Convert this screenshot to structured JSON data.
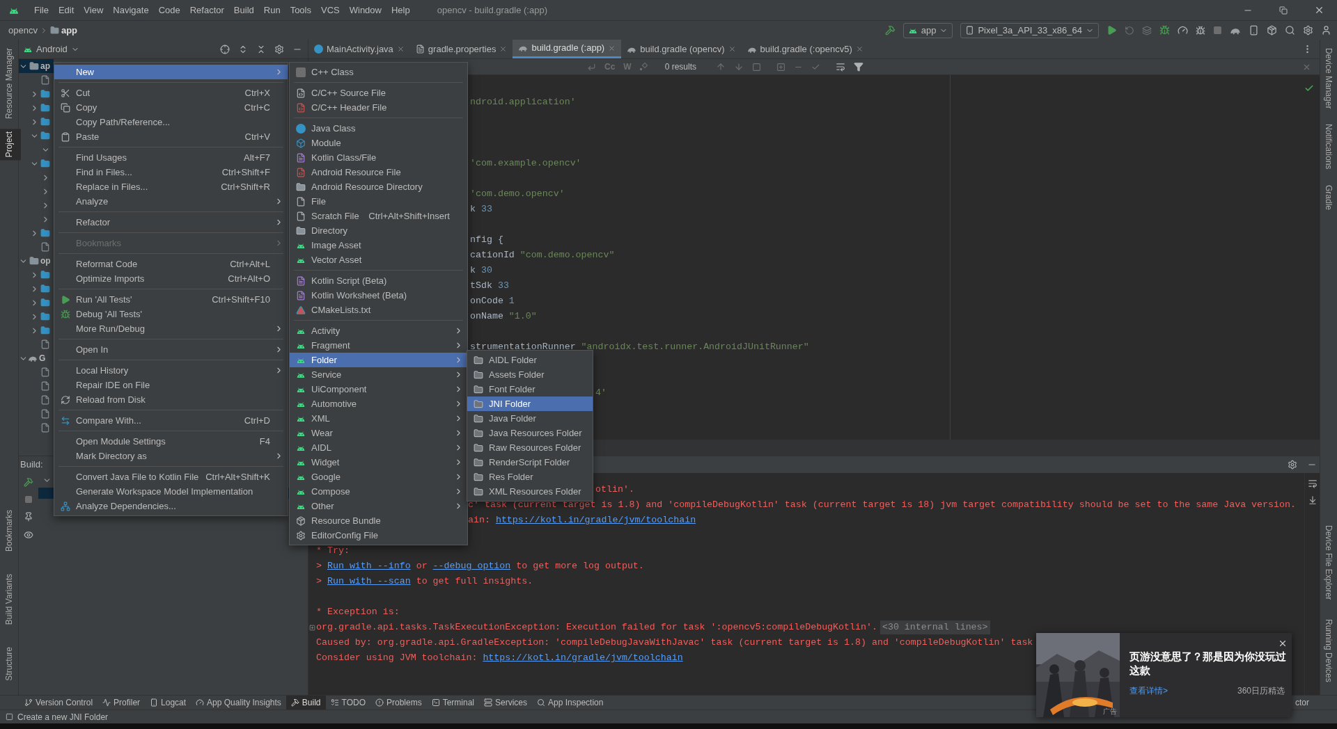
{
  "title_bar": {
    "menu": [
      "File",
      "Edit",
      "View",
      "Navigate",
      "Code",
      "Refactor",
      "Build",
      "Run",
      "Tools",
      "VCS",
      "Window",
      "Help"
    ],
    "title": "opencv - build.gradle (:app)"
  },
  "nav_bar": {
    "crumbs": [
      "opencv",
      "app"
    ],
    "run_config": "app",
    "device": "Pixel_3a_API_33_x86_64"
  },
  "left_stripe": {
    "top": [
      {
        "label": "Resource Manager",
        "selected": false
      },
      {
        "label": "Project",
        "selected": true
      }
    ],
    "bottom": [
      "Bookmarks",
      "Build Variants",
      "Structure"
    ]
  },
  "right_stripe": {
    "top": [
      "Device Manager",
      "Notifications",
      "Gradle"
    ],
    "bottom": [
      "Device File Explorer",
      "Running Devices"
    ]
  },
  "project_panel": {
    "view": "Android",
    "tree": [
      {
        "label": "ap",
        "kind": "module",
        "selected": true,
        "expanded": true,
        "children": [
          {
            "kind": "leaf"
          },
          {
            "kind": "folder",
            "expanded": false
          },
          {
            "kind": "folder",
            "expanded": false
          },
          {
            "kind": "folder",
            "expanded": false
          },
          {
            "kind": "folder",
            "expanded": true,
            "children": [
              {
                "expanded": true
              }
            ]
          },
          {
            "kind": "folder",
            "expanded": true,
            "children": [
              {
                "expanded": false
              },
              {
                "expanded": false
              },
              {
                "expanded": false
              },
              {
                "expanded": false
              }
            ]
          },
          {
            "kind": "folder",
            "expanded": false
          },
          {
            "kind": "leaf"
          }
        ]
      },
      {
        "label": "op",
        "kind": "module",
        "selected": false,
        "expanded": true,
        "children": [
          {
            "kind": "folder",
            "expanded": false
          },
          {
            "kind": "folder",
            "expanded": false
          },
          {
            "kind": "folder",
            "expanded": false
          },
          {
            "kind": "folder",
            "expanded": false
          },
          {
            "kind": "folder",
            "expanded": false
          },
          {
            "kind": "leaf"
          }
        ]
      },
      {
        "label": "G",
        "kind": "gradle",
        "selected": false,
        "expanded": true,
        "children": [
          {
            "kind": "leaf"
          },
          {
            "kind": "leaf"
          },
          {
            "kind": "leaf"
          },
          {
            "kind": "leaf"
          },
          {
            "kind": "leaf"
          }
        ]
      }
    ]
  },
  "editor": {
    "tabs": [
      {
        "label": "MainActivity.java",
        "selected": false
      },
      {
        "label": "gradle.properties",
        "selected": false
      },
      {
        "label": "build.gradle (:app)",
        "selected": true
      },
      {
        "label": "build.gradle (opencv)",
        "selected": false
      },
      {
        "label": "build.gradle (:opencv5)",
        "selected": false
      }
    ],
    "find": {
      "toggles": [
        "Cc",
        "W"
      ],
      "results": "0 results"
    },
    "lines": [
      {
        "kind": "after_menu",
        "parts": [
          {
            "kind": "string",
            "text": "ndroid.application'"
          }
        ]
      },
      {
        "kind": "blank"
      },
      {
        "kind": "blank"
      },
      {
        "kind": "blank"
      },
      {
        "kind": "after_menu",
        "parts": [
          {
            "kind": "string",
            "text": "'com.example.opencv'"
          }
        ]
      },
      {
        "kind": "blank"
      },
      {
        "kind": "after_menu",
        "parts": [
          {
            "kind": "string",
            "text": "'com.demo.opencv'"
          }
        ]
      },
      {
        "kind": "after_menu",
        "parts": [
          {
            "kind": "plain",
            "text": "k "
          },
          {
            "kind": "number",
            "text": "33"
          }
        ]
      },
      {
        "kind": "blank"
      },
      {
        "kind": "after_menu",
        "parts": [
          {
            "kind": "plain",
            "text": "nfig {"
          }
        ]
      },
      {
        "kind": "after_menu",
        "parts": [
          {
            "kind": "plain",
            "text": "cationId "
          },
          {
            "kind": "string",
            "text": "\"com.demo.opencv\""
          }
        ]
      },
      {
        "kind": "after_menu",
        "parts": [
          {
            "kind": "plain",
            "text": "k "
          },
          {
            "kind": "number",
            "text": "30"
          }
        ]
      },
      {
        "kind": "after_menu",
        "parts": [
          {
            "kind": "plain",
            "text": "tSdk "
          },
          {
            "kind": "number",
            "text": "33"
          }
        ]
      },
      {
        "kind": "after_menu",
        "parts": [
          {
            "kind": "plain",
            "text": "onCode "
          },
          {
            "kind": "number",
            "text": "1"
          }
        ]
      },
      {
        "kind": "after_menu",
        "parts": [
          {
            "kind": "plain",
            "text": "onName "
          },
          {
            "kind": "string",
            "text": "\"1.0\""
          }
        ]
      },
      {
        "kind": "blank"
      },
      {
        "kind": "after_menu",
        "parts": [
          {
            "kind": "plain",
            "text": "strumentationRunner "
          },
          {
            "kind": "string",
            "text": "\"androidx.test.runner.AndroidJUnitRunner\""
          }
        ]
      },
      {
        "kind": "blank"
      },
      {
        "kind": "blank"
      },
      {
        "kind": "after_submenu",
        "parts": [
          {
            "kind": "string",
            "text": "4'"
          }
        ]
      }
    ]
  },
  "build": {
    "title": "Build:",
    "console": [
      {
        "kind": "after_submenu",
        "parts": [
          {
            "kind": "error",
            "text": "otlin'."
          }
        ]
      },
      {
        "kind": "after_menu",
        "parts": [
          {
            "kind": "error",
            "text": "c' task (current target is 1.8) and 'compileDebugKotlin' task (current target is 18) jvm target compatibility should be set to the same Java version."
          }
        ]
      },
      {
        "kind": "after_menu",
        "parts": [
          {
            "kind": "error",
            "text": "ain: "
          },
          {
            "kind": "link",
            "text": "https://kotl.in/gradle/jvm/toolchain"
          }
        ]
      },
      {
        "kind": "blank"
      },
      {
        "kind": "full",
        "parts": [
          {
            "kind": "error",
            "text": "* Try:"
          }
        ]
      },
      {
        "kind": "full",
        "parts": [
          {
            "kind": "error",
            "text": "> "
          },
          {
            "kind": "link",
            "text": "Run with --info"
          },
          {
            "kind": "error",
            "text": " or "
          },
          {
            "kind": "link",
            "text": "--debug option"
          },
          {
            "kind": "error",
            "text": " to get more log output."
          }
        ]
      },
      {
        "kind": "full",
        "parts": [
          {
            "kind": "error",
            "text": "> "
          },
          {
            "kind": "link",
            "text": "Run with --scan"
          },
          {
            "kind": "error",
            "text": " to get full insights."
          }
        ]
      },
      {
        "kind": "blank"
      },
      {
        "kind": "full",
        "parts": [
          {
            "kind": "error",
            "text": "* Exception is:"
          }
        ]
      },
      {
        "kind": "full",
        "folded": true,
        "parts": [
          {
            "kind": "error",
            "text": "org.gradle.api.tasks.TaskExecutionException: Execution failed for task ':opencv5:compileDebugKotlin'."
          },
          {
            "kind": "fold",
            "text": "<30 internal lines>"
          }
        ]
      },
      {
        "kind": "full",
        "parts": [
          {
            "kind": "error",
            "text": "Caused by: org.gradle.api.GradleException: 'compileDebugJavaWithJavac' task (current target is 1.8) and 'compileDebugKotlin' task"
          }
        ]
      },
      {
        "kind": "full",
        "parts": [
          {
            "kind": "error",
            "text": "Consider using JVM toolchain: "
          },
          {
            "kind": "link",
            "text": "https://kotl.in/gradle/jvm/toolchain"
          }
        ]
      }
    ]
  },
  "context_menu": {
    "items": [
      {
        "kind": "item",
        "label": "New",
        "submenu": true,
        "selected": true,
        "disabled": false
      },
      {
        "kind": "separator"
      },
      {
        "kind": "item",
        "label": "Cut",
        "shortcut": "Ctrl+X",
        "submenu": false,
        "selected": false,
        "disabled": false
      },
      {
        "kind": "item",
        "label": "Copy",
        "shortcut": "Ctrl+C",
        "submenu": false,
        "selected": false,
        "disabled": false
      },
      {
        "kind": "item",
        "label": "Copy Path/Reference...",
        "submenu": false,
        "selected": false,
        "disabled": false
      },
      {
        "kind": "item",
        "label": "Paste",
        "shortcut": "Ctrl+V",
        "submenu": false,
        "selected": false,
        "disabled": false
      },
      {
        "kind": "separator"
      },
      {
        "kind": "item",
        "label": "Find Usages",
        "shortcut": "Alt+F7",
        "submenu": false,
        "selected": false,
        "disabled": false
      },
      {
        "kind": "item",
        "label": "Find in Files...",
        "shortcut": "Ctrl+Shift+F",
        "submenu": false,
        "selected": false,
        "disabled": false
      },
      {
        "kind": "item",
        "label": "Replace in Files...",
        "shortcut": "Ctrl+Shift+R",
        "submenu": false,
        "selected": false,
        "disabled": false
      },
      {
        "kind": "item",
        "label": "Analyze",
        "submenu": true,
        "selected": false,
        "disabled": false
      },
      {
        "kind": "separator"
      },
      {
        "kind": "item",
        "label": "Refactor",
        "submenu": true,
        "selected": false,
        "disabled": false
      },
      {
        "kind": "separator"
      },
      {
        "kind": "item",
        "label": "Bookmarks",
        "submenu": true,
        "selected": false,
        "disabled": true
      },
      {
        "kind": "separator"
      },
      {
        "kind": "item",
        "label": "Reformat Code",
        "shortcut": "Ctrl+Alt+L",
        "submenu": false,
        "selected": false,
        "disabled": false
      },
      {
        "kind": "item",
        "label": "Optimize Imports",
        "shortcut": "Ctrl+Alt+O",
        "submenu": false,
        "selected": false,
        "disabled": false
      },
      {
        "kind": "separator"
      },
      {
        "kind": "item",
        "label": "Run 'All Tests'",
        "shortcut": "Ctrl+Shift+F10",
        "submenu": false,
        "selected": false,
        "disabled": false
      },
      {
        "kind": "item",
        "label": "Debug 'All Tests'",
        "submenu": false,
        "selected": false,
        "disabled": false
      },
      {
        "kind": "item",
        "label": "More Run/Debug",
        "submenu": true,
        "selected": false,
        "disabled": false
      },
      {
        "kind": "separator"
      },
      {
        "kind": "item",
        "label": "Open In",
        "submenu": true,
        "selected": false,
        "disabled": false
      },
      {
        "kind": "separator"
      },
      {
        "kind": "item",
        "label": "Local History",
        "submenu": true,
        "selected": false,
        "disabled": false
      },
      {
        "kind": "item",
        "label": "Repair IDE on File",
        "submenu": false,
        "selected": false,
        "disabled": false
      },
      {
        "kind": "item",
        "label": "Reload from Disk",
        "submenu": false,
        "selected": false,
        "disabled": false
      },
      {
        "kind": "separator"
      },
      {
        "kind": "item",
        "label": "Compare With...",
        "shortcut": "Ctrl+D",
        "submenu": false,
        "selected": false,
        "disabled": false
      },
      {
        "kind": "separator"
      },
      {
        "kind": "item",
        "label": "Open Module Settings",
        "shortcut": "F4",
        "submenu": false,
        "selected": false,
        "disabled": false
      },
      {
        "kind": "item",
        "label": "Mark Directory as",
        "submenu": true,
        "selected": false,
        "disabled": false
      },
      {
        "kind": "separator"
      },
      {
        "kind": "item",
        "label": "Convert Java File to Kotlin File",
        "shortcut": "Ctrl+Alt+Shift+K",
        "submenu": false,
        "selected": false,
        "disabled": false
      },
      {
        "kind": "item",
        "label": "Generate Workspace Model Implementation",
        "submenu": false,
        "selected": false,
        "disabled": false
      },
      {
        "kind": "item",
        "label": "Analyze Dependencies...",
        "submenu": false,
        "selected": false,
        "disabled": false
      }
    ]
  },
  "new_menu": {
    "items": [
      {
        "kind": "item",
        "label": "C++ Class",
        "submenu": false,
        "selected": false
      },
      {
        "kind": "separator"
      },
      {
        "kind": "item",
        "label": "C/C++ Source File",
        "submenu": false,
        "selected": false
      },
      {
        "kind": "item",
        "label": "C/C++ Header File",
        "submenu": false,
        "selected": false
      },
      {
        "kind": "separator"
      },
      {
        "kind": "item",
        "label": "Java Class",
        "submenu": false,
        "selected": false
      },
      {
        "kind": "item",
        "label": "Module",
        "submenu": false,
        "selected": false
      },
      {
        "kind": "item",
        "label": "Kotlin Class/File",
        "submenu": false,
        "selected": false
      },
      {
        "kind": "item",
        "label": "Android Resource File",
        "submenu": false,
        "selected": false
      },
      {
        "kind": "item",
        "label": "Android Resource Directory",
        "submenu": false,
        "selected": false
      },
      {
        "kind": "item",
        "label": "File",
        "submenu": false,
        "selected": false
      },
      {
        "kind": "item",
        "label": "Scratch File",
        "shortcut": "Ctrl+Alt+Shift+Insert",
        "submenu": false,
        "selected": false
      },
      {
        "kind": "item",
        "label": "Directory",
        "submenu": false,
        "selected": false
      },
      {
        "kind": "item",
        "label": "Image Asset",
        "submenu": false,
        "selected": false
      },
      {
        "kind": "item",
        "label": "Vector Asset",
        "submenu": false,
        "selected": false
      },
      {
        "kind": "separator"
      },
      {
        "kind": "item",
        "label": "Kotlin Script (Beta)",
        "submenu": false,
        "selected": false
      },
      {
        "kind": "item",
        "label": "Kotlin Worksheet (Beta)",
        "submenu": false,
        "selected": false
      },
      {
        "kind": "item",
        "label": "CMakeLists.txt",
        "submenu": false,
        "selected": false
      },
      {
        "kind": "separator"
      },
      {
        "kind": "item",
        "label": "Activity",
        "submenu": true,
        "selected": false
      },
      {
        "kind": "item",
        "label": "Fragment",
        "submenu": true,
        "selected": false
      },
      {
        "kind": "item",
        "label": "Folder",
        "submenu": true,
        "selected": true
      },
      {
        "kind": "item",
        "label": "Service",
        "submenu": true,
        "selected": false
      },
      {
        "kind": "item",
        "label": "UiComponent",
        "submenu": true,
        "selected": false
      },
      {
        "kind": "item",
        "label": "Automotive",
        "submenu": true,
        "selected": false
      },
      {
        "kind": "item",
        "label": "XML",
        "submenu": true,
        "selected": false
      },
      {
        "kind": "item",
        "label": "Wear",
        "submenu": true,
        "selected": false
      },
      {
        "kind": "item",
        "label": "AIDL",
        "submenu": true,
        "selected": false
      },
      {
        "kind": "item",
        "label": "Widget",
        "submenu": true,
        "selected": false
      },
      {
        "kind": "item",
        "label": "Google",
        "submenu": true,
        "selected": false
      },
      {
        "kind": "item",
        "label": "Compose",
        "submenu": true,
        "selected": false
      },
      {
        "kind": "item",
        "label": "Other",
        "submenu": true,
        "selected": false
      },
      {
        "kind": "item",
        "label": "Resource Bundle",
        "submenu": false,
        "selected": false
      },
      {
        "kind": "item",
        "label": "EditorConfig File",
        "submenu": false,
        "selected": false
      }
    ]
  },
  "folder_menu": {
    "items": [
      {
        "kind": "item",
        "label": "AIDL Folder",
        "submenu": false,
        "selected": false
      },
      {
        "kind": "item",
        "label": "Assets Folder",
        "submenu": false,
        "selected": false
      },
      {
        "kind": "item",
        "label": "Font Folder",
        "submenu": false,
        "selected": false
      },
      {
        "kind": "item",
        "label": "JNI Folder",
        "submenu": false,
        "selected": true
      },
      {
        "kind": "item",
        "label": "Java Folder",
        "submenu": false,
        "selected": false
      },
      {
        "kind": "item",
        "label": "Java Resources Folder",
        "submenu": false,
        "selected": false
      },
      {
        "kind": "item",
        "label": "Raw Resources Folder",
        "submenu": false,
        "selected": false
      },
      {
        "kind": "item",
        "label": "RenderScript Folder",
        "submenu": false,
        "selected": false
      },
      {
        "kind": "item",
        "label": "Res Folder",
        "submenu": false,
        "selected": false
      },
      {
        "kind": "item",
        "label": "XML Resources Folder",
        "submenu": false,
        "selected": false
      }
    ]
  },
  "tool_windows": [
    {
      "label": "Version Control",
      "selected": false
    },
    {
      "label": "Profiler",
      "selected": false
    },
    {
      "label": "Logcat",
      "selected": false
    },
    {
      "label": "App Quality Insights",
      "selected": false
    },
    {
      "label": "Build",
      "selected": true
    },
    {
      "label": "TODO",
      "selected": false
    },
    {
      "label": "Problems",
      "selected": false
    },
    {
      "label": "Terminal",
      "selected": false
    },
    {
      "label": "Services",
      "selected": false
    },
    {
      "label": "App Inspection",
      "selected": false
    }
  ],
  "tool_windows_right": "ctor",
  "status": "Create a new JNI Folder",
  "ad": {
    "headline": "页游没意思了？那是因为你没玩过这款",
    "link": "查看详情>",
    "source": "360日历精选",
    "tag": "广告"
  }
}
